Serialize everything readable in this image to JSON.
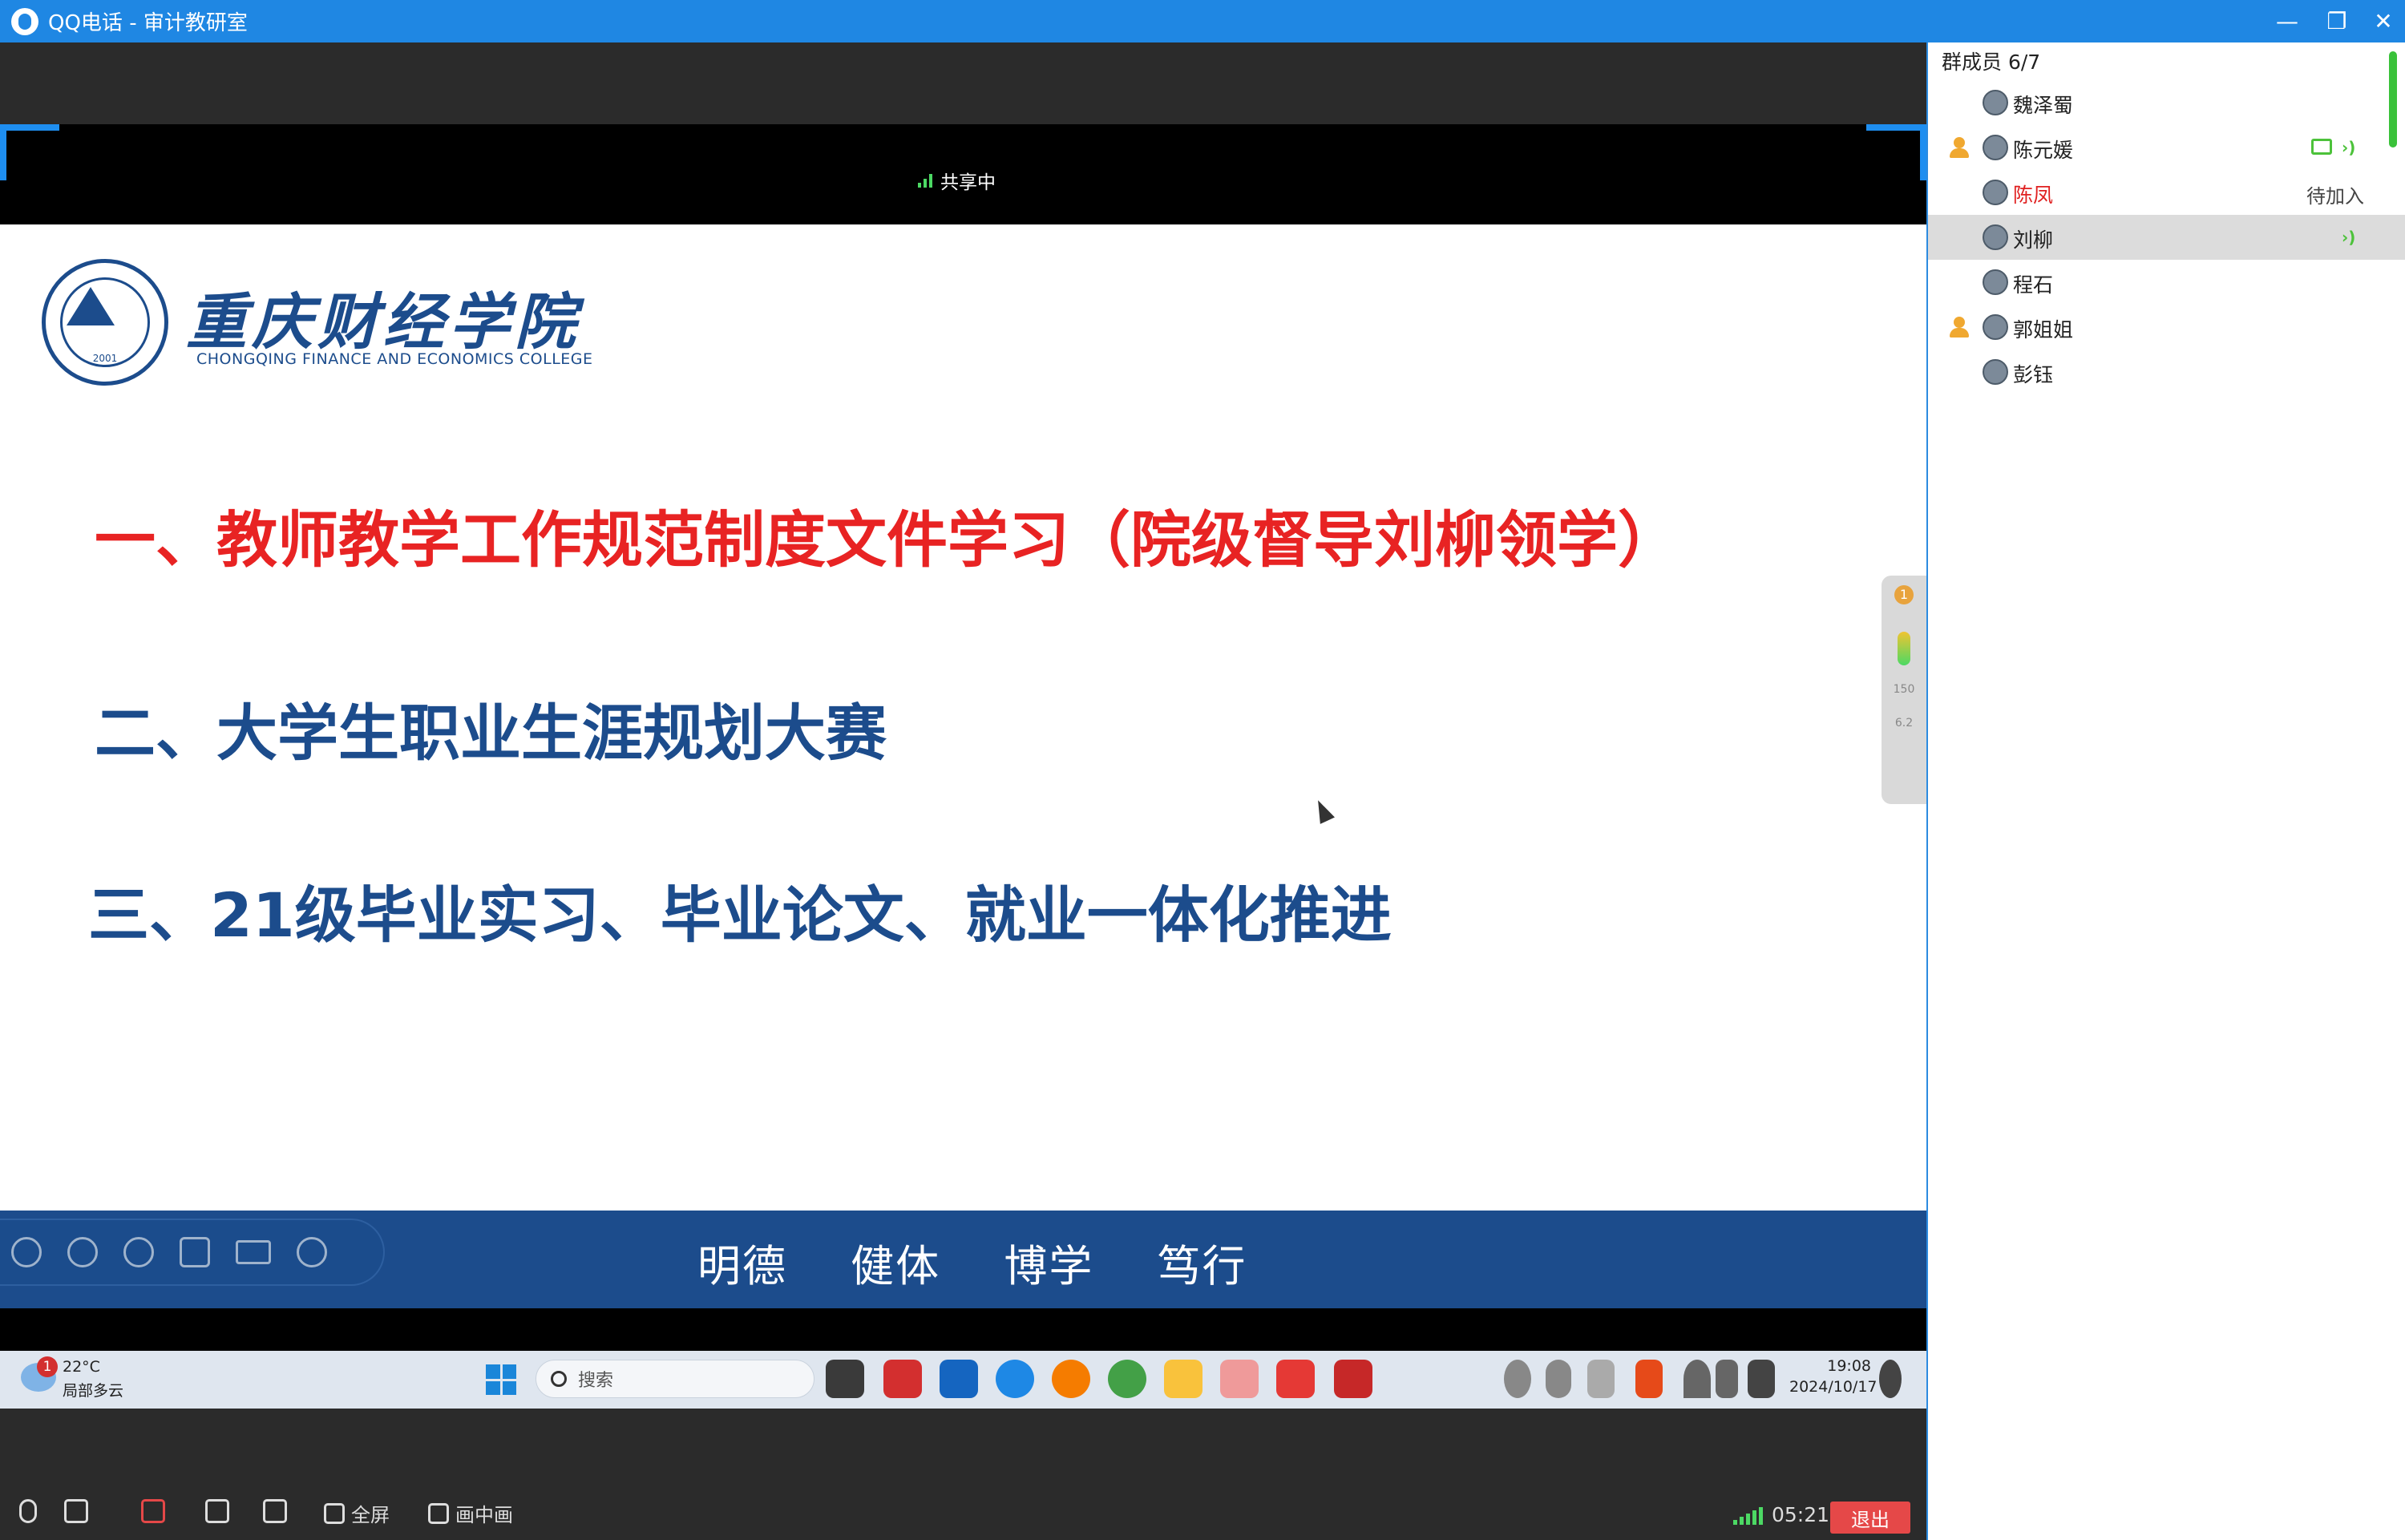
{
  "window": {
    "app_name": "QQ电话",
    "separator": "-",
    "group_name": "审计教研室",
    "minimize": "—",
    "restore": "❐",
    "close": "✕"
  },
  "share": {
    "status": "共享中"
  },
  "slide": {
    "school_cn": "重庆财经学院",
    "school_en": "CHONGQING FINANCE AND ECONOMICS COLLEGE",
    "seal_year": "2001",
    "item1": "一、教师教学工作规范制度文件学习（院级督导刘柳领学）",
    "item2": "二、大学生职业生涯规划大赛",
    "item3": "三、21级毕业实习、毕业论文、就业一体化推进",
    "motto": "明德 健体 博学 笃行"
  },
  "float_widget": {
    "badge": "1",
    "up": "150",
    "down": "6.2"
  },
  "captured_taskbar": {
    "weather_badge": "1",
    "temperature": "22°C",
    "weather_desc": "局部多云",
    "search_placeholder": "搜索",
    "time": "19:08",
    "date": "2024/10/17"
  },
  "controls": {
    "fullscreen": "全屏",
    "pip": "画中画",
    "timer": "05:21",
    "exit": "退出"
  },
  "members": {
    "header": "群成员 6/7",
    "list": [
      {
        "name": "魏泽蜀"
      },
      {
        "name": "陈元媛"
      },
      {
        "name": "陈凤",
        "status": "待加入"
      },
      {
        "name": "刘柳"
      },
      {
        "name": "程石"
      },
      {
        "name": "郭姐姐"
      },
      {
        "name": "彭钰"
      }
    ]
  },
  "colors": {
    "titlebar": "#1f87e3",
    "slide_blue": "#1c4c8c",
    "slide_red": "#e82323",
    "exit": "#e54848",
    "active_green": "#4cc23a"
  }
}
